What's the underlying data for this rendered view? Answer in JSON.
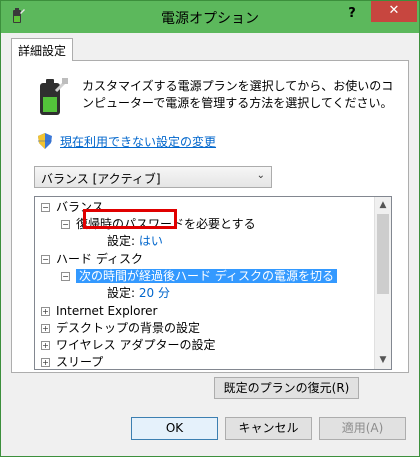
{
  "window": {
    "title": "電源オプション",
    "help_label": "?",
    "close_label": "✕"
  },
  "tabs": [
    {
      "label": "詳細設定"
    }
  ],
  "description": "カスタマイズする電源プランを選択してから、お使いのコンピューターで電源を管理する方法を選択してください。",
  "change_link": "現在利用できない設定の変更",
  "plan_select": {
    "selected": "バランス [アクティブ]"
  },
  "tree": [
    {
      "expander": "⊟",
      "label": "バランス"
    },
    {
      "expander": "⊟",
      "label": "復帰時のパスワードを必要とする"
    },
    {
      "setting_label": "設定:",
      "setting_value": "はい"
    },
    {
      "expander": "⊟",
      "label": "ハード ディスク"
    },
    {
      "expander": "⊟",
      "label": "次の時間が経過後ハード ディスクの電源を切る"
    },
    {
      "setting_label": "設定:",
      "setting_value": "20 分"
    },
    {
      "expander": "⊞",
      "label": "Internet Explorer"
    },
    {
      "expander": "⊞",
      "label": "デスクトップの背景の設定"
    },
    {
      "expander": "⊞",
      "label": "ワイヤレス アダプターの設定"
    },
    {
      "expander": "⊞",
      "label": "スリープ"
    }
  ],
  "buttons": {
    "restore": "既定のプランの復元(R)",
    "ok": "OK",
    "cancel": "キャンセル",
    "apply": "適用(A)"
  },
  "colors": {
    "titlebar": "#5cb85c",
    "close": "#c7463f",
    "link": "#0066cc",
    "selection": "#3399ff",
    "highlight_box": "#e00000"
  }
}
